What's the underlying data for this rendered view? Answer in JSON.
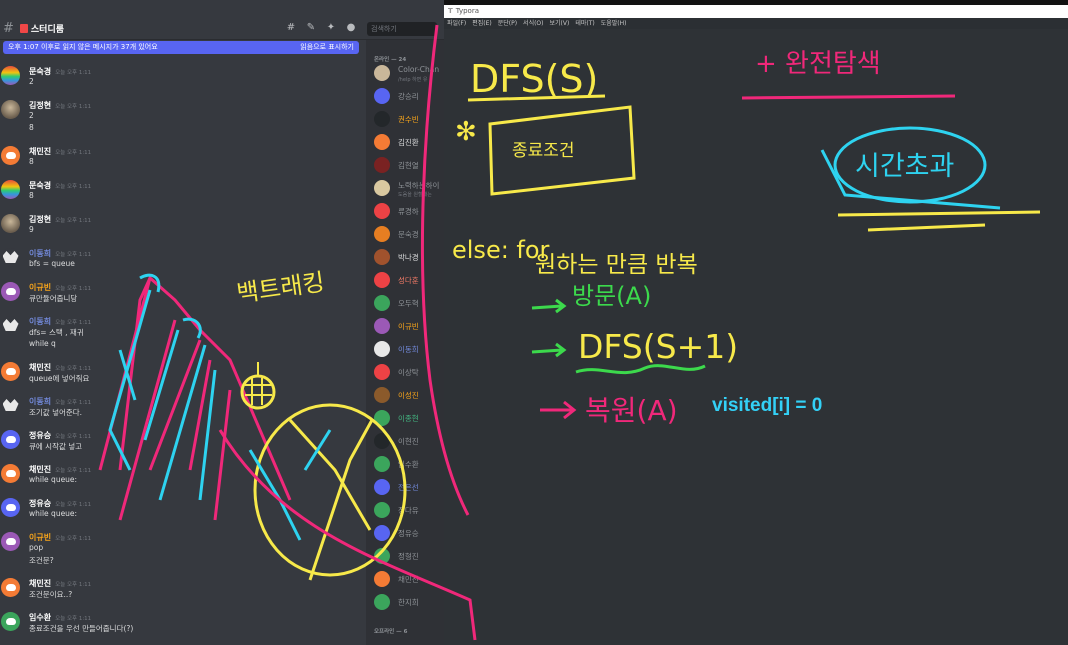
{
  "discord": {
    "channel_name": "스터디룸",
    "search_placeholder": "검색하기",
    "unread_banner": "오후 1:07 이후로 읽지 않은 메시지가 37개 있어요",
    "mark_read": "읽음으로 표시하기",
    "messages": [
      {
        "author": "문숙경",
        "time": "오늘 오후 1:11",
        "lines": [
          "2"
        ],
        "avatar": "rainbow",
        "color": "white"
      },
      {
        "author": "김정현",
        "time": "오늘 오후 1:11",
        "lines": [
          "2",
          "8"
        ],
        "avatar": "photo",
        "color": "white"
      },
      {
        "author": "채민진",
        "time": "오늘 오후 1:11",
        "lines": [
          "8"
        ],
        "avatar": "orange",
        "color": "white"
      },
      {
        "author": "문숙경",
        "time": "오늘 오후 1:11",
        "lines": [
          "8"
        ],
        "avatar": "rainbow",
        "color": "white"
      },
      {
        "author": "김정현",
        "time": "오늘 오후 1:11",
        "lines": [
          "9"
        ],
        "avatar": "photo",
        "color": "white"
      },
      {
        "author": "이동희",
        "time": "오늘 오후 1:11",
        "lines": [
          "bfs = queue"
        ],
        "avatar": "white",
        "color": "blue"
      },
      {
        "author": "이규빈",
        "time": "오늘 오후 1:11",
        "lines": [
          "큐만듈어줍니당"
        ],
        "avatar": "purple",
        "color": "orange"
      },
      {
        "author": "이동희",
        "time": "오늘 오후 1:11",
        "lines": [
          "dfs= 스택 , 재귀",
          "while q"
        ],
        "avatar": "white",
        "color": "blue"
      },
      {
        "author": "채민진",
        "time": "오늘 오후 1:11",
        "lines": [
          "queue에 넣어줘요"
        ],
        "avatar": "orange",
        "color": "white"
      },
      {
        "author": "이동희",
        "time": "오늘 오후 1:11",
        "lines": [
          "조기값 넣어준다."
        ],
        "avatar": "white",
        "color": "blue"
      },
      {
        "author": "정유승",
        "time": "오늘 오후 1:11",
        "lines": [
          "큐에 시작값 넣고"
        ],
        "avatar": "blurple",
        "color": "white"
      },
      {
        "author": "채민진",
        "time": "오늘 오후 1:11",
        "lines": [
          "while queue:"
        ],
        "avatar": "orange",
        "color": "white"
      },
      {
        "author": "정유승",
        "time": "오늘 오후 1:11",
        "lines": [
          "while queue:"
        ],
        "avatar": "blurple",
        "color": "white"
      },
      {
        "author": "이규빈",
        "time": "오늘 오후 1:11",
        "lines": [
          "pop",
          "조건문?"
        ],
        "avatar": "purple",
        "color": "orange"
      },
      {
        "author": "채민진",
        "time": "오늘 오후 1:11",
        "lines": [
          "조건문이요..?"
        ],
        "avatar": "orange",
        "color": "white"
      },
      {
        "author": "임수환",
        "time": "오늘 오후 1:11",
        "lines": [
          "종료조건을 우선 만들어줍니다(?)"
        ],
        "avatar": "green",
        "color": "white"
      }
    ],
    "online_header": "온라인 — 24",
    "offline_header": "오프라인 — 6",
    "members": [
      {
        "name": "Color-Chan",
        "sub": "/help 하면 유",
        "avatar": "#c9b79a",
        "color": "#8e9297"
      },
      {
        "name": "강승리",
        "sub": "",
        "avatar": "#5865f2",
        "color": "#8e9297"
      },
      {
        "name": "권수빈",
        "sub": "",
        "avatar": "#23272a",
        "color": "#faa61a"
      },
      {
        "name": "김진환",
        "sub": "",
        "avatar": "#f47b35",
        "color": "#dcddde"
      },
      {
        "name": "김현열",
        "sub": "",
        "avatar": "#7a2222",
        "color": "#8e9297"
      },
      {
        "name": "노력하는하이",
        "sub": "도움을 원할때는",
        "avatar": "#d9c8a0",
        "color": "#8e9297"
      },
      {
        "name": "류경하",
        "sub": "",
        "avatar": "#ed4245",
        "color": "#8e9297"
      },
      {
        "name": "문숙경",
        "sub": "",
        "avatar": "#e67e22",
        "color": "#8e9297"
      },
      {
        "name": "박나경",
        "sub": "",
        "avatar": "#a0522d",
        "color": "#dcddde"
      },
      {
        "name": "성다훈",
        "sub": "",
        "avatar": "#ed4245",
        "color": "#f47b67"
      },
      {
        "name": "오두혁",
        "sub": "",
        "avatar": "#3ba55c",
        "color": "#8e9297"
      },
      {
        "name": "이규빈",
        "sub": "",
        "avatar": "#9b59b6",
        "color": "#faa61a"
      },
      {
        "name": "이동희",
        "sub": "",
        "avatar": "#e8e8e8",
        "color": "#7289da"
      },
      {
        "name": "이상탁",
        "sub": "",
        "avatar": "#ed4245",
        "color": "#8e9297"
      },
      {
        "name": "이성진",
        "sub": "",
        "avatar": "#8b5a2b",
        "color": "#faa61a"
      },
      {
        "name": "이종현",
        "sub": "",
        "avatar": "#3ba55c",
        "color": "#43b581"
      },
      {
        "name": "이현진",
        "sub": "",
        "avatar": "#23272a",
        "color": "#8e9297"
      },
      {
        "name": "임수환",
        "sub": "",
        "avatar": "#3ba55c",
        "color": "#8e9297"
      },
      {
        "name": "전은선",
        "sub": "",
        "avatar": "#5865f2",
        "color": "#7289da"
      },
      {
        "name": "정다유",
        "sub": "",
        "avatar": "#3ba55c",
        "color": "#8e9297"
      },
      {
        "name": "정유승",
        "sub": "",
        "avatar": "#5865f2",
        "color": "#8e9297"
      },
      {
        "name": "정형진",
        "sub": "",
        "avatar": "#3ba55c",
        "color": "#8e9297"
      },
      {
        "name": "채민진",
        "sub": "",
        "avatar": "#f47b35",
        "color": "#8e9297"
      },
      {
        "name": "한지희",
        "sub": "",
        "avatar": "#3ba55c",
        "color": "#8e9297"
      }
    ]
  },
  "typora": {
    "title": "Typora",
    "menu": [
      "파일(F)",
      "편집(E)",
      "문단(P)",
      "서식(O)",
      "보기(V)",
      "테마(T)",
      "도움말(H)"
    ],
    "visited_text": "visited[i] = 0"
  },
  "handwriting": {
    "dfs_title": "DFS(S)",
    "complete_search": "+ 완전탐색",
    "time_over": "시간초과",
    "end_condition": "종료조건",
    "else_for": "else: for",
    "repeat": "원하는 만큼 반복",
    "visit": "방문(A)",
    "dfs_recursive": "DFS(S+1)",
    "restore": "복원(A)",
    "backtracking": "백트래킹"
  },
  "colors": {
    "yellow": "#f7e94a",
    "magenta": "#f0287a",
    "cyan": "#2ed3f0",
    "green": "#3cd94c",
    "blue_text": "#33d1f7"
  }
}
